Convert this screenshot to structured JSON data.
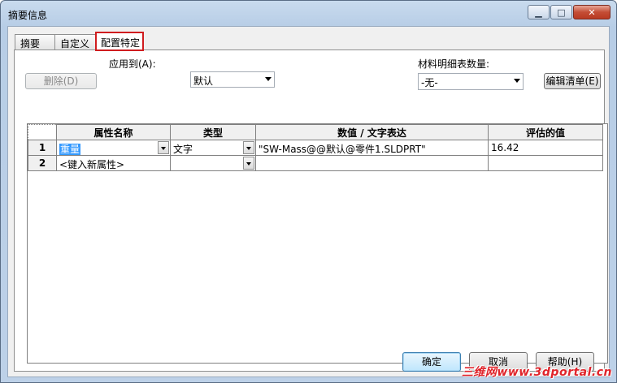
{
  "window": {
    "title": "摘要信息",
    "controls": {
      "minimize": "▁",
      "maximize": "□",
      "close": "✕"
    }
  },
  "tabs": [
    {
      "label": "摘要",
      "active": false
    },
    {
      "label": "自定义",
      "active": false
    },
    {
      "label": "配置特定",
      "active": true,
      "highlight_color": "#d01c1f"
    }
  ],
  "toolbar": {
    "delete_button": "删除(D)",
    "apply_to_label": "应用到(A):",
    "apply_to_value": "默认",
    "bom_qty_label": "材料明细表数量:",
    "bom_qty_value": "-无-",
    "edit_list_button": "编辑清单(E)"
  },
  "table": {
    "headers": [
      "属性名称",
      "类型",
      "数值 / 文字表达",
      "评估的值"
    ],
    "rows": [
      {
        "num": "1",
        "name": "重量",
        "type": "文字",
        "value": "\"SW-Mass@@默认@零件1.SLDPRT\"",
        "evaluated": "16.42",
        "name_selected": true
      },
      {
        "num": "2",
        "name": "<键入新属性>",
        "type": "",
        "value": "",
        "evaluated": ""
      }
    ]
  },
  "footer": {
    "ok_button": "确定",
    "cancel_button": "取消",
    "help_button": "帮助(H)"
  },
  "watermark": "三维网www.3dportal.cn",
  "colors": {
    "selection": "#3399ff",
    "tab_highlight": "#d01c1f"
  }
}
